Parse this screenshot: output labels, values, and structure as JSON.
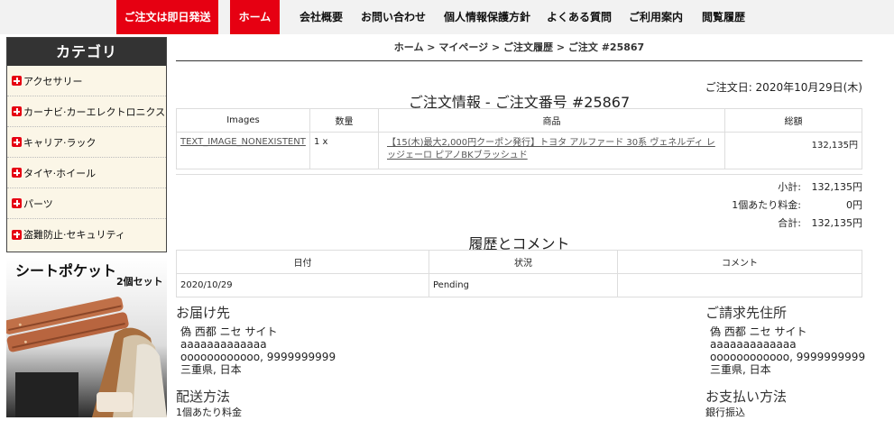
{
  "nav": {
    "promo": "ご注文は即日発送",
    "home": "ホーム",
    "company": "会社概要",
    "contact": "お問い合わせ",
    "privacy": "個人情報保護方針",
    "faq": "よくある質問",
    "guide": "ご利用案内",
    "history": "閲覧履歴"
  },
  "sidebar": {
    "title": "カテゴリ",
    "items": [
      "アクセサリー",
      "カーナビ·カーエレクトロニクス",
      "キャリア·ラック",
      "タイヤ·ホイール",
      "パーツ",
      "盗難防止·セキュリティ"
    ]
  },
  "banner": {
    "title": "シートポケット",
    "subtitle": "2個セット"
  },
  "breadcrumb": "ホーム >  マイページ >  ご注文履歴 >  ご注文   #25867",
  "order": {
    "date": "ご注文日: 2020年10月29日(木)",
    "title": "ご注文情報 - ご注文番号   #25867",
    "headers": [
      "Images",
      "数量",
      "商品",
      "総額"
    ],
    "rows": [
      {
        "image": "TEXT_IMAGE_NONEXISTENT",
        "qty": "1 x",
        "product": "【15(木)最大2,000円クーポン発行】トヨタ アルファード 30系 ヴェネルディ レッジェーロ ピアノBKブラッシュド",
        "total": "132,135円"
      }
    ]
  },
  "totals": {
    "subtotal_label": "小計:",
    "subtotal": "132,135円",
    "per_item_label": "1個あたり料金:",
    "per_item": "0円",
    "total_label": "合計:",
    "total": "132,135円"
  },
  "history": {
    "title": "履歴とコメント",
    "headers": [
      "日付",
      "状況",
      "コメント"
    ],
    "rows": [
      {
        "date": "2020/10/29",
        "status": "Pending",
        "comment": ""
      }
    ]
  },
  "delivery": {
    "title": "お届け先",
    "name": "偽   西都 ニセ   サイト",
    "line1": "aaaaaaaaaaaaa",
    "line2": "oooooooooooo, 9999999999",
    "line3": "三重県, 日本"
  },
  "billing": {
    "title": "ご請求先住所",
    "name": "偽   西都 ニセ   サイト",
    "line1": "aaaaaaaaaaaaa",
    "line2": "oooooooooooo, 9999999999",
    "line3": "三重県, 日本"
  },
  "shipping": {
    "title": "配送方法",
    "value": "1個あたり料金"
  },
  "payment": {
    "title": "お支払い方法",
    "value": "銀行振込"
  }
}
